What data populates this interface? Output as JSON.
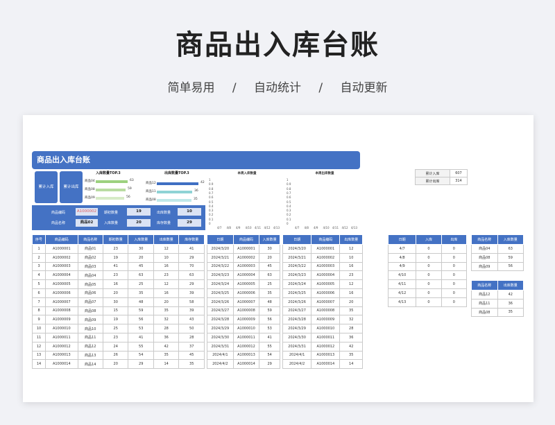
{
  "hero": {
    "title": "商品出入库台账",
    "tags": [
      "简单易用",
      "/",
      "自动统计",
      "/",
      "自动更新"
    ]
  },
  "sheet": {
    "banner": "商品出入库台账",
    "stat_buttons": [
      "累计入库",
      "累计出库"
    ],
    "inbound_top3": {
      "title": "入库数量TOP.3",
      "items": [
        {
          "name": "商品04",
          "value": 63
        },
        {
          "name": "商品08",
          "value": 59
        },
        {
          "name": "商品09",
          "value": 56
        }
      ],
      "colors": [
        "#9dd17f",
        "#b9dca2",
        "#d6ebc6"
      ]
    },
    "outbound_top3": {
      "title": "出库数量TOP.3",
      "items": [
        {
          "name": "商品12",
          "value": 42
        },
        {
          "name": "商品11",
          "value": 36
        },
        {
          "name": "商品08",
          "value": 35
        }
      ],
      "colors": [
        "#3f6fc3",
        "#8fd3d5",
        "#bfe8e9"
      ]
    },
    "lookup": {
      "code_label": "商品编码",
      "code_value": "A1000002",
      "name_label": "商品名称",
      "name_value": "商品02",
      "opening_label": "期初数量",
      "opening_value": "19",
      "in_label": "入库数量",
      "in_value": "20",
      "out_label": "出库数量",
      "out_value": "10",
      "stock_label": "库存数量",
      "stock_value": "29"
    },
    "week_in_chart": {
      "title": "本周入库数量",
      "y_ticks": [
        "1",
        "0.9",
        "0.8",
        "0.7",
        "0.6",
        "0.5",
        "0.4",
        "0.3",
        "0.2",
        "0.1",
        "0"
      ],
      "x_ticks": [
        "4/7",
        "4/8",
        "4/9",
        "4/10",
        "4/11",
        "4/12",
        "4/13"
      ]
    },
    "week_out_chart": {
      "title": "本周出库数量",
      "y_ticks": [
        "1",
        "0.9",
        "0.8",
        "0.7",
        "0.6",
        "0.5",
        "0.4",
        "0.3",
        "0.2",
        "0.1",
        "0"
      ],
      "x_ticks": [
        "4/7",
        "4/8",
        "4/9",
        "4/10",
        "4/11",
        "4/12",
        "4/13"
      ]
    },
    "totals": [
      {
        "label": "累计入库",
        "value": "607"
      },
      {
        "label": "累计出库",
        "value": "314"
      }
    ],
    "main_table": {
      "headers": [
        "序号",
        "商品编码",
        "商品名称",
        "期初数量",
        "入库数量",
        "出库数量",
        "库存数量"
      ],
      "rows": [
        [
          "1",
          "A1000001",
          "商品01",
          "23",
          "30",
          "12",
          "41"
        ],
        [
          "2",
          "A1000002",
          "商品02",
          "19",
          "20",
          "10",
          "29"
        ],
        [
          "3",
          "A1000003",
          "商品03",
          "41",
          "45",
          "16",
          "70"
        ],
        [
          "4",
          "A1000004",
          "商品04",
          "23",
          "63",
          "23",
          "63"
        ],
        [
          "5",
          "A1000005",
          "商品05",
          "16",
          "25",
          "12",
          "29"
        ],
        [
          "6",
          "A1000006",
          "商品06",
          "20",
          "35",
          "16",
          "39"
        ],
        [
          "7",
          "A1000007",
          "商品07",
          "30",
          "48",
          "20",
          "58"
        ],
        [
          "8",
          "A1000008",
          "商品08",
          "15",
          "59",
          "35",
          "39"
        ],
        [
          "9",
          "A1000009",
          "商品09",
          "19",
          "56",
          "32",
          "43"
        ],
        [
          "10",
          "A1000010",
          "商品10",
          "25",
          "53",
          "28",
          "50"
        ],
        [
          "11",
          "A1000011",
          "商品11",
          "23",
          "41",
          "36",
          "28"
        ],
        [
          "12",
          "A1000012",
          "商品12",
          "24",
          "55",
          "42",
          "37"
        ],
        [
          "13",
          "A1000013",
          "商品13",
          "26",
          "54",
          "35",
          "45"
        ],
        [
          "14",
          "A1000014",
          "商品14",
          "20",
          "29",
          "14",
          "35"
        ]
      ]
    },
    "in_log": {
      "headers": [
        "日期",
        "商品编码",
        "入库数量"
      ],
      "rows": [
        [
          "2024/3/20",
          "A1000001",
          "30"
        ],
        [
          "2024/3/21",
          "A1000002",
          "20"
        ],
        [
          "2024/3/22",
          "A1000003",
          "45"
        ],
        [
          "2024/3/23",
          "A1000004",
          "63"
        ],
        [
          "2024/3/24",
          "A1000005",
          "25"
        ],
        [
          "2024/3/25",
          "A1000006",
          "35"
        ],
        [
          "2024/3/26",
          "A1000007",
          "48"
        ],
        [
          "2024/3/27",
          "A1000008",
          "59"
        ],
        [
          "2024/3/28",
          "A1000009",
          "56"
        ],
        [
          "2024/3/29",
          "A1000010",
          "53"
        ],
        [
          "2024/3/30",
          "A1000011",
          "41"
        ],
        [
          "2024/3/31",
          "A1000012",
          "55"
        ],
        [
          "2024/4/1",
          "A1000013",
          "54"
        ],
        [
          "2024/4/2",
          "A1000014",
          "29"
        ]
      ]
    },
    "out_log": {
      "headers": [
        "日期",
        "商品编码",
        "出库数量"
      ],
      "rows": [
        [
          "2024/3/20",
          "A1000001",
          "12"
        ],
        [
          "2024/3/21",
          "A1000002",
          "10"
        ],
        [
          "2024/3/22",
          "A1000003",
          "16"
        ],
        [
          "2024/3/23",
          "A1000004",
          "23"
        ],
        [
          "2024/3/24",
          "A1000005",
          "12"
        ],
        [
          "2024/3/25",
          "A1000006",
          "16"
        ],
        [
          "2024/3/26",
          "A1000007",
          "20"
        ],
        [
          "2024/3/27",
          "A1000008",
          "35"
        ],
        [
          "2024/3/28",
          "A1000009",
          "32"
        ],
        [
          "2024/3/29",
          "A1000010",
          "28"
        ],
        [
          "2024/3/30",
          "A1000011",
          "36"
        ],
        [
          "2024/3/31",
          "A1000012",
          "42"
        ],
        [
          "2024/4/1",
          "A1000013",
          "35"
        ],
        [
          "2024/4/2",
          "A1000014",
          "14"
        ]
      ]
    },
    "week_table": {
      "headers": [
        "日期",
        "入库",
        "出库"
      ],
      "rows": [
        [
          "4/7",
          "0",
          "0"
        ],
        [
          "4/8",
          "0",
          "0"
        ],
        [
          "4/9",
          "0",
          "0"
        ],
        [
          "4/10",
          "0",
          "0"
        ],
        [
          "4/11",
          "0",
          "0"
        ],
        [
          "4/12",
          "0",
          "0"
        ],
        [
          "4/13",
          "0",
          "0"
        ]
      ]
    },
    "top_in_table": {
      "headers": [
        "商品名称",
        "入库数量"
      ],
      "rows": [
        [
          "商品04",
          "63"
        ],
        [
          "商品08",
          "59"
        ],
        [
          "商品09",
          "56"
        ]
      ]
    },
    "top_out_table": {
      "headers": [
        "商品名称",
        "出库数量"
      ],
      "rows": [
        [
          "商品12",
          "42"
        ],
        [
          "商品11",
          "36"
        ],
        [
          "商品08",
          "35"
        ]
      ]
    }
  }
}
